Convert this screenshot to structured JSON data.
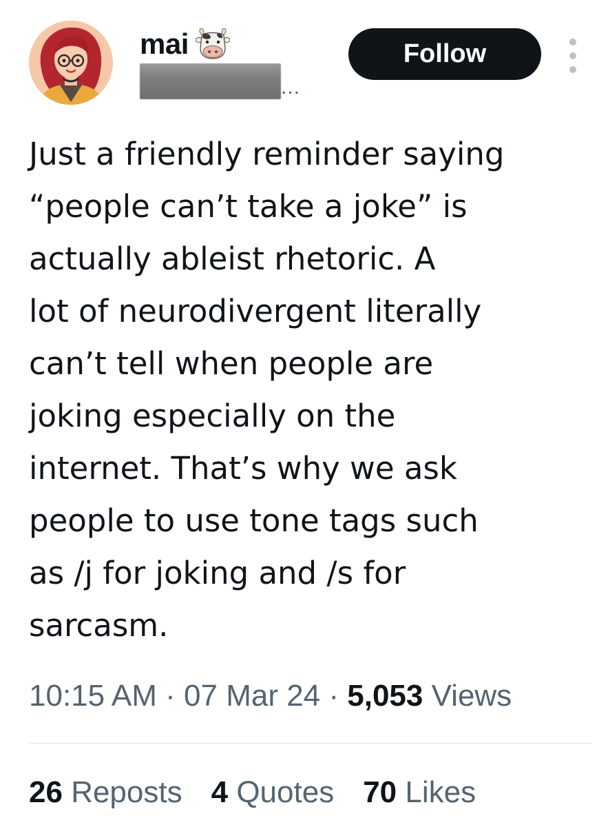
{
  "author": {
    "display_name": "mai",
    "name_emoji_icon": "cow-face-icon",
    "handle_ellipsis": "...",
    "avatar_icon": "cartoon-avatar-red-hair"
  },
  "header": {
    "follow_label": "Follow",
    "more_icon": "more-vertical-icon"
  },
  "tweet": {
    "lines": [
      "Just a friendly reminder saying",
      "“people can’t take a joke” is",
      "actually ableist rhetoric. A",
      "lot of neurodivergent literally",
      "can’t tell when people are",
      "joking especially on the",
      "internet. That’s why we ask",
      "people to use tone tags such",
      "as /j for joking and /s for",
      "sarcasm."
    ]
  },
  "meta": {
    "time": "10:15 AM",
    "separator": "·",
    "date": "07 Mar 24",
    "views_count": "5,053",
    "views_label": "Views"
  },
  "stats": {
    "reposts_count": "26",
    "reposts_label": "Reposts",
    "quotes_count": "4",
    "quotes_label": "Quotes",
    "likes_count": "70",
    "likes_label": "Likes"
  },
  "colors": {
    "text_primary": "#0f1419",
    "text_secondary": "#536471",
    "follow_bg": "#0f1419",
    "divider": "#e3e8ec"
  }
}
